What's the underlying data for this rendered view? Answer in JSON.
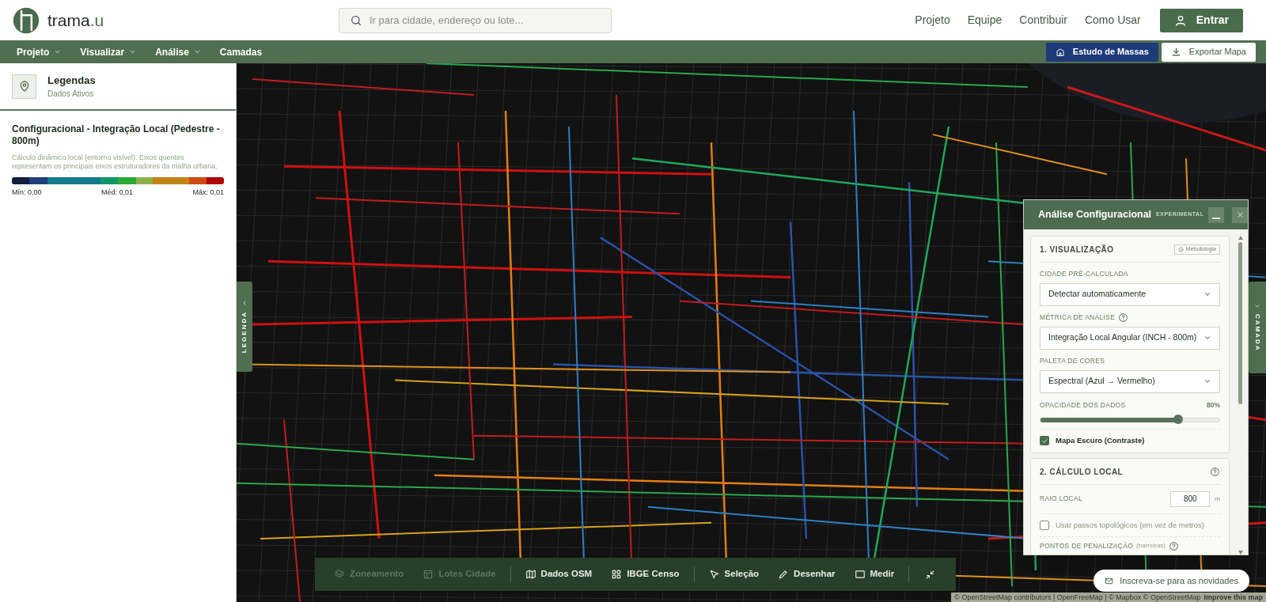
{
  "logo": {
    "name": "trama",
    "suffix": ".u"
  },
  "search": {
    "placeholder": "Ir para cidade, endereço ou lote..."
  },
  "top_links": [
    "Projeto",
    "Equipe",
    "Contribuir",
    "Como Usar"
  ],
  "login_button": "Entrar",
  "menu": [
    {
      "label": "Projeto",
      "dropdown": true
    },
    {
      "label": "Visualizar",
      "dropdown": true
    },
    {
      "label": "Análise",
      "dropdown": true
    },
    {
      "label": "Camadas",
      "dropdown": false
    }
  ],
  "actions": [
    {
      "label": "Estudo de Massas",
      "kind": "primary"
    },
    {
      "label": "Exportar Mapa",
      "kind": "secondary"
    }
  ],
  "legend_panel": {
    "title": "Legendas",
    "subtitle": "Dados Ativos",
    "layer_title": "Configuracional - Integração Local (Pedestre - 800m)",
    "description": "Cálculo dinâmico local (entorno visível). Eixos quentes representam os principais eixos estruturadores da malha urbana.",
    "scale": [
      {
        "color": "#0f1f3d"
      },
      {
        "color": "#1f3f7a"
      },
      {
        "color": "#127a8c"
      },
      {
        "color": "#11956a"
      },
      {
        "color": "#2aaa35"
      },
      {
        "color": "#8db04f"
      },
      {
        "color": "#c38417"
      },
      {
        "color": "#cc4a0c"
      },
      {
        "color": "#ad0303"
      }
    ],
    "min": "Mín: 0,00",
    "mid": "Méd: 0,01",
    "max": "Máx: 0,01"
  },
  "side_tabs": {
    "left": "LEGENDA",
    "right": "CAMADA"
  },
  "analysis_panel": {
    "title": "Análise Configuracional",
    "badge": "EXPERIMENTAL",
    "sections": [
      {
        "title": "1. VISUALIZAÇÃO",
        "button": "Metodologia",
        "help": false,
        "fields": [
          {
            "kind": "select",
            "label": "CIDADE PRÉ-CALCULADA",
            "help": false,
            "value": "Detectar automaticamente"
          },
          {
            "kind": "select",
            "label": "MÉTRICA DE ANÁLISE",
            "help": true,
            "value": "Integração Local Angular (INCH - 800m)"
          },
          {
            "kind": "select",
            "label": "PALETA DE CORES",
            "help": false,
            "value": "Espectral (Azul → Vermelho)"
          },
          {
            "kind": "slider",
            "label": "OPACIDADE DOS DADOS",
            "reading": "80%",
            "level": 0.77
          },
          {
            "kind": "checkbox",
            "label": "Mapa Escuro (Contraste)",
            "checked": true
          }
        ]
      },
      {
        "title": "2. CÁLCULO LOCAL",
        "help": true,
        "fields": [
          {
            "kind": "number",
            "label": "RAIO LOCAL",
            "value": "800",
            "unit": "m"
          },
          {
            "kind": "checkbox",
            "label": "Usar passos topológicos (em vez de metros)",
            "checked": false
          },
          {
            "kind": "heading",
            "label": "PONTOS DE PENALIZAÇÃO",
            "note": "(barreiras)",
            "help": true
          }
        ]
      }
    ]
  },
  "toolbar": [
    [
      {
        "label": "Zoneamento",
        "kind": "layers",
        "disabled": true
      },
      {
        "label": "Lotes Cidade",
        "kind": "table",
        "disabled": true
      }
    ],
    [
      {
        "label": "Dados OSM",
        "kind": "map",
        "disabled": false
      },
      {
        "label": "IBGE Censo",
        "kind": "grid",
        "disabled": false
      }
    ],
    [
      {
        "label": "Seleção",
        "kind": "cursor",
        "disabled": false
      },
      {
        "label": "Desenhar",
        "kind": "pen",
        "disabled": false
      },
      {
        "label": "Medir",
        "kind": "ruler",
        "disabled": false
      }
    ]
  ],
  "subscribe_button": "Inscreva-se para as novidades",
  "attribution": {
    "text": "© OpenStreetMap contributors | OpenFreeMap | © Mapbox © OpenStreetMap",
    "link": "Improve this map"
  }
}
